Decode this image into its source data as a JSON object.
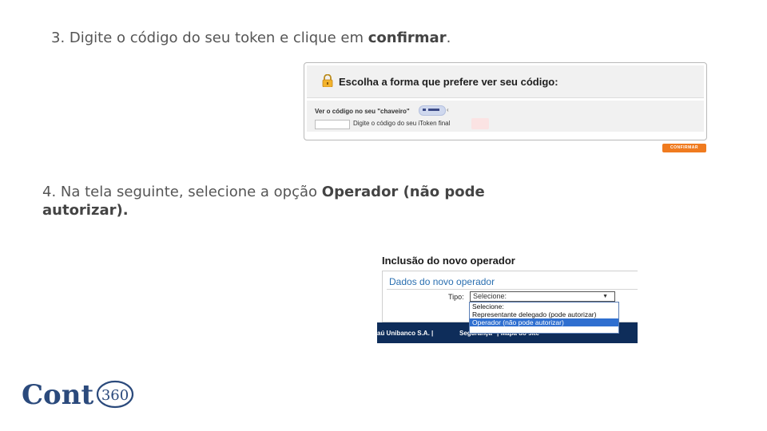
{
  "step3": {
    "prefix": "3. Digite o código do seu token e clique em ",
    "bold": "confirmar",
    "suffix": "."
  },
  "token_panel": {
    "title": "Escolha a forma que prefere ver seu código:",
    "chaveiro_label": "Ver o código no seu \"chaveiro\"",
    "code_hint": "Digite o código do seu iToken final",
    "confirm_button": "CONFIRMAR"
  },
  "step4": {
    "prefix": "4. Na tela seguinte, selecione a opção ",
    "bold": "Operador (não pode autorizar)."
  },
  "operator_panel": {
    "title": "Inclusão do novo operador",
    "subtitle": "Dados do novo operador",
    "tipo_label": "Tipo:",
    "tipo_selected": "Selecione:",
    "options": [
      "Selecione:",
      "Representante delegado (pode autorizar)",
      "Operador (não pode autorizar)"
    ],
    "footer": {
      "company": "aú Unibanco S.A.   |",
      "security": "Segurança",
      "map": "|    Mapa do site"
    }
  },
  "logo": {
    "text": "Cont",
    "number": "360"
  },
  "colors": {
    "accent": "#f07b1f",
    "selection": "#2f6fd0",
    "footer": "#0e2d5a",
    "logo": "#2b4a7c"
  }
}
